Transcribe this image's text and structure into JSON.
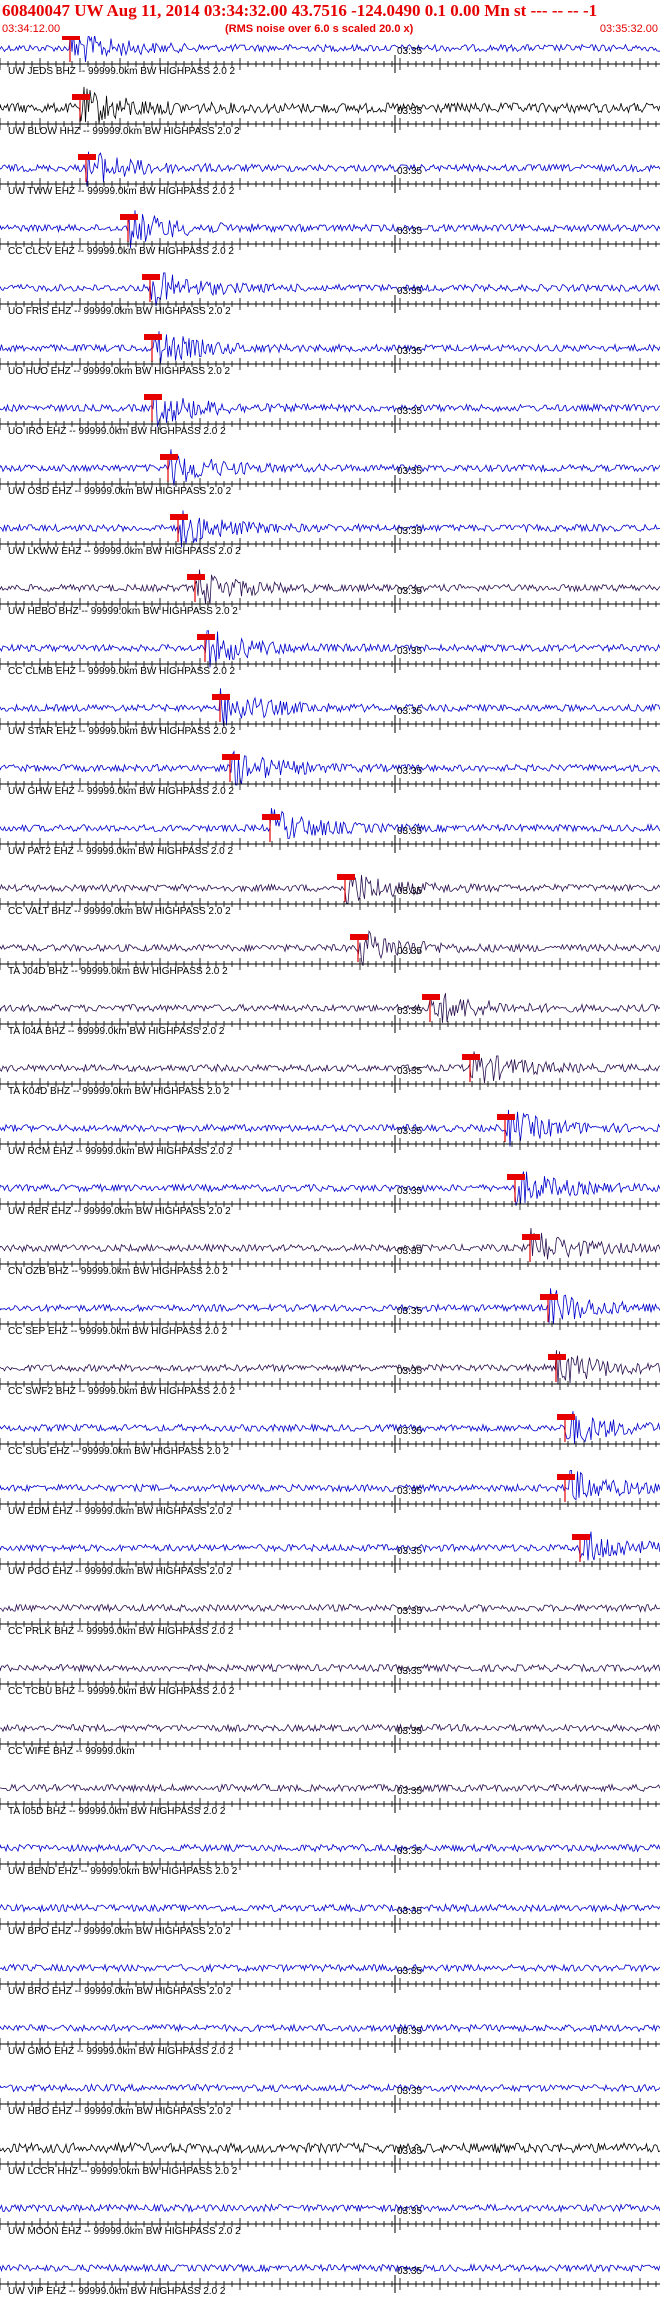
{
  "header": {
    "title": "60840047 UW Aug 11, 2014 03:34:32.00   43.7516 -124.0490  0.1 0.00 Mn st --- -- --  -1",
    "start_time": "03:34:12.00",
    "note": "(RMS noise over 6.0 s scaled 20.0 x)",
    "end_time": "03:35:32.00"
  },
  "colors": {
    "header_text": "#e60000",
    "trace_blue": "#0000cc",
    "trace_dark": "#2a1050",
    "trace_black": "#000000",
    "pick_red": "#e60000",
    "axis": "#000000"
  },
  "tick_label": "03:35",
  "stations": [
    {
      "label": "UW JEDS BHZ -- 99999.0km BW  HIGHPASS  2.0  2",
      "color": "blue",
      "pick": true
    },
    {
      "label": "UW BLOW HHZ -- 99999.0km BW  HIGHPASS  2.0  2",
      "color": "black",
      "pick": true
    },
    {
      "label": "UW TWW EHZ -- 99999.0km BW  HIGHPASS  2.0  2",
      "color": "blue",
      "pick": true
    },
    {
      "label": "CC CLCV EHZ -- 99999.0km BW  HIGHPASS  2.0  2",
      "color": "blue",
      "pick": true
    },
    {
      "label": "UO FRIS EHZ -- 99999.0km BW  HIGHPASS  2.0  2",
      "color": "blue",
      "pick": true
    },
    {
      "label": "UO HUO EHZ -- 99999.0km BW  HIGHPASS  2.0  2",
      "color": "blue",
      "pick": true
    },
    {
      "label": "UO IRO EHZ -- 99999.0km BW  HIGHPASS  2.0  2",
      "color": "blue",
      "pick": true
    },
    {
      "label": "UW OSD EHZ -- 99999.0km BW  HIGHPASS  2.0  2",
      "color": "blue",
      "pick": true
    },
    {
      "label": "UW LKWW EHZ -- 99999.0km BW  HIGHPASS  2.0  2",
      "color": "blue",
      "pick": true
    },
    {
      "label": "UW HEBO BHZ -- 99999.0km BW  HIGHPASS  2.0  2",
      "color": "dark",
      "pick": true
    },
    {
      "label": "CC CLMB EHZ -- 99999.0km BW  HIGHPASS  2.0  2",
      "color": "blue",
      "pick": true
    },
    {
      "label": "UW STAR EHZ -- 99999.0km BW  HIGHPASS  2.0  2",
      "color": "blue",
      "pick": true
    },
    {
      "label": "UW GHW EHZ -- 99999.0km BW  HIGHPASS  2.0  2",
      "color": "blue",
      "pick": true
    },
    {
      "label": "UW PAT2 EHZ -- 99999.0km BW  HIGHPASS  2.0  2",
      "color": "blue",
      "pick": true
    },
    {
      "label": "CC VALT BHZ -- 99999.0km BW  HIGHPASS  2.0  2",
      "color": "dark",
      "pick": true
    },
    {
      "label": "TA J04D BHZ -- 99999.0km BW  HIGHPASS  2.0  2",
      "color": "dark",
      "pick": true
    },
    {
      "label": "TA I04A BHZ -- 99999.0km BW  HIGHPASS  2.0  2",
      "color": "dark",
      "pick": true
    },
    {
      "label": "TA K04D BHZ -- 99999.0km BW  HIGHPASS  2.0  2",
      "color": "dark",
      "pick": true
    },
    {
      "label": "UW RCM EHZ -- 99999.0km BW  HIGHPASS  2.0  2",
      "color": "blue",
      "pick": true
    },
    {
      "label": "UW RER EHZ -- 99999.0km BW  HIGHPASS  2.0  2",
      "color": "blue",
      "pick": true
    },
    {
      "label": "CN OZB BHZ -- 99999.0km BW  HIGHPASS  2.0  2",
      "color": "dark",
      "pick": true
    },
    {
      "label": "CC SEP EHZ -- 99999.0km BW  HIGHPASS  2.0  2",
      "color": "blue",
      "pick": true
    },
    {
      "label": "CC SWF2 BHZ -- 99999.0km BW  HIGHPASS  2.0  2",
      "color": "dark",
      "pick": true
    },
    {
      "label": "CC SUG EHZ -- 99999.0km BW  HIGHPASS  2.0  2",
      "color": "blue",
      "pick": true
    },
    {
      "label": "UW EDM EHZ -- 99999.0km BW  HIGHPASS  2.0  2",
      "color": "blue",
      "pick": true
    },
    {
      "label": "UW PGO EHZ -- 99999.0km BW  HIGHPASS  2.0  2",
      "color": "blue",
      "pick": true
    },
    {
      "label": "CC PRLK BHZ -- 99999.0km BW  HIGHPASS  2.0  2",
      "color": "dark",
      "pick": false
    },
    {
      "label": "CC TCBU BHZ -- 99999.0km BW  HIGHPASS  2.0  2",
      "color": "dark",
      "pick": false
    },
    {
      "label": "CC WIFE BHZ -- 99999.0km",
      "color": "dark",
      "pick": false
    },
    {
      "label": "TA I05D BHZ -- 99999.0km BW  HIGHPASS  2.0  2",
      "color": "dark",
      "pick": false
    },
    {
      "label": "UW BEND EHZ -- 99999.0km BW  HIGHPASS  2.0  2",
      "color": "blue",
      "pick": false
    },
    {
      "label": "UW BPO EHZ -- 99999.0km BW  HIGHPASS  2.0  2",
      "color": "blue",
      "pick": false
    },
    {
      "label": "UW BRO EHZ -- 99999.0km BW  HIGHPASS  2.0  2",
      "color": "blue",
      "pick": false
    },
    {
      "label": "UW GMO EHZ -- 99999.0km BW  HIGHPASS  2.0  2",
      "color": "blue",
      "pick": false
    },
    {
      "label": "UW HBO EHZ -- 99999.0km BW  HIGHPASS  2.0  2",
      "color": "blue",
      "pick": false
    },
    {
      "label": "UW LCCR HHZ -- 99999.0km BW  HIGHPASS  2.0  2",
      "color": "black",
      "pick": false
    },
    {
      "label": "UW MOON EHZ -- 99999.0km BW  HIGHPASS  2.0  2",
      "color": "blue",
      "pick": false
    },
    {
      "label": "UW VIP EHZ -- 99999.0km BW  HIGHPASS  2.0  2",
      "color": "blue",
      "pick": false
    }
  ]
}
